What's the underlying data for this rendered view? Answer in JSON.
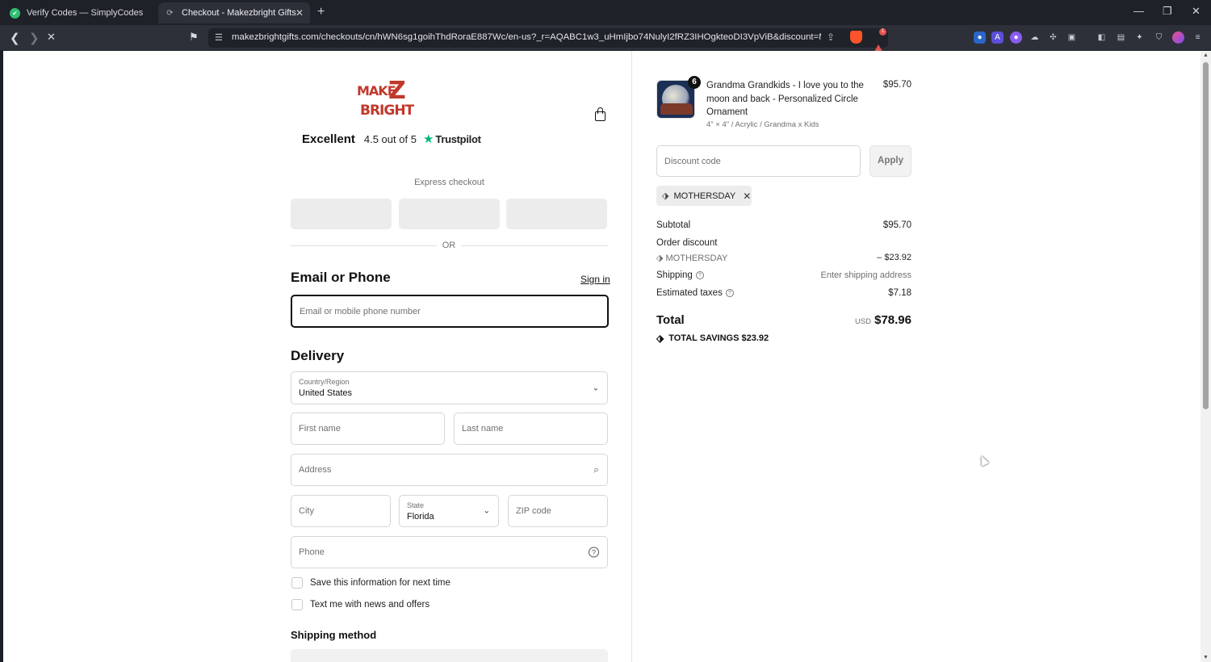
{
  "browser": {
    "tabs": [
      {
        "title": "Verify Codes — SimplyCodes",
        "active": false
      },
      {
        "title": "Checkout - Makezbright Gifts",
        "active": true
      }
    ],
    "url": "makezbrightgifts.com/checkouts/cn/hWN6sg1goihThdRoraE887Wc/en-us?_r=AQABC1w3_uHmIjbo74NulyI2fRZ3IHOgkteoDI3VpViB&discount=MOT..."
  },
  "store": {
    "logo_line1": "MAKE",
    "logo_z": "Z",
    "logo_line2": "BRIGHT",
    "rating_word": "Excellent",
    "rating_score": "4.5 out of 5",
    "rating_brand": "Trustpilot"
  },
  "checkout": {
    "express_label": "Express checkout",
    "or_label": "OR",
    "contact_heading": "Email or Phone",
    "sign_in": "Sign in",
    "email_placeholder": "Email or mobile phone number",
    "delivery_heading": "Delivery",
    "country_label": "Country/Region",
    "country_value": "United States",
    "first_name_placeholder": "First name",
    "last_name_placeholder": "Last name",
    "address_placeholder": "Address",
    "city_placeholder": "City",
    "state_label": "State",
    "state_value": "Florida",
    "zip_placeholder": "ZIP code",
    "phone_placeholder": "Phone",
    "save_info_label": "Save this information for next time",
    "text_me_label": "Text me with news and offers",
    "shipping_method_heading": "Shipping method"
  },
  "summary": {
    "item": {
      "quantity": "6",
      "title": "Grandma Grandkids - I love you to the moon and back - Personalized Circle Ornament",
      "variant": "4\" × 4\" / Acrylic / Grandma x Kids",
      "price": "$95.70"
    },
    "discount_placeholder": "Discount code",
    "apply_label": "Apply",
    "applied_code": "MOTHERSDAY",
    "subtotal_label": "Subtotal",
    "subtotal_value": "$95.70",
    "order_discount_label": "Order discount",
    "order_discount_code": "MOTHERSDAY",
    "order_discount_value": "– $23.92",
    "shipping_label": "Shipping",
    "shipping_value": "Enter shipping address",
    "taxes_label": "Estimated taxes",
    "taxes_value": "$7.18",
    "total_label": "Total",
    "total_currency": "USD",
    "total_value": "$78.96",
    "savings_label": "TOTAL SAVINGS",
    "savings_value": "$23.92"
  }
}
